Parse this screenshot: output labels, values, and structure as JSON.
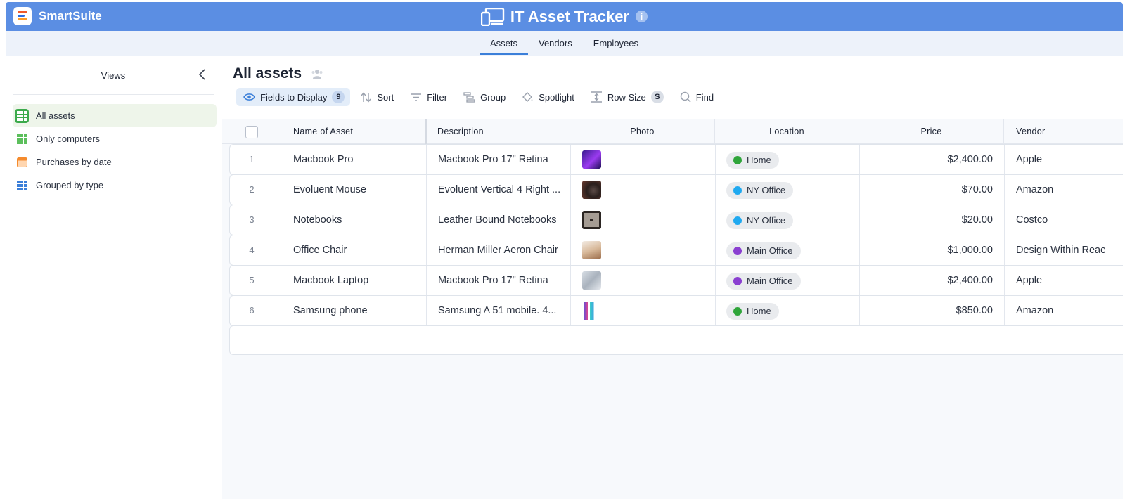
{
  "brand": {
    "name": "SmartSuite"
  },
  "app": {
    "title": "IT Asset Tracker",
    "info": "i"
  },
  "tabs": [
    {
      "label": "Assets",
      "active": true
    },
    {
      "label": "Vendors",
      "active": false
    },
    {
      "label": "Employees",
      "active": false
    }
  ],
  "sidebar": {
    "title": "Views",
    "items": [
      {
        "label": "All assets",
        "icon": "grid-icon",
        "active": true
      },
      {
        "label": "Only computers",
        "icon": "grid-icon",
        "active": false
      },
      {
        "label": "Purchases by date",
        "icon": "calendar-icon",
        "active": false
      },
      {
        "label": "Grouped by type",
        "icon": "grid-icon",
        "active": false
      }
    ]
  },
  "main": {
    "title": "All assets",
    "toolbar": {
      "fields": {
        "label": "Fields to Display",
        "count": "9"
      },
      "sort": "Sort",
      "filter": "Filter",
      "group": "Group",
      "spotlight": "Spotlight",
      "rowsize": {
        "label": "Row Size",
        "value": "S"
      },
      "find": "Find"
    }
  },
  "table": {
    "columns": {
      "name": "Name of Asset",
      "description": "Description",
      "photo": "Photo",
      "location": "Location",
      "price": "Price",
      "vendor": "Vendor"
    },
    "rows": [
      {
        "num": "1",
        "name": "Macbook Pro",
        "description": "Macbook Pro 17\" Retina",
        "location": "Home",
        "location_color": "#2fa53a",
        "price": "$2,400.00",
        "vendor": "Apple"
      },
      {
        "num": "2",
        "name": "Evoluent Mouse",
        "description": "Evoluent Vertical 4 Right ...",
        "location": "NY Office",
        "location_color": "#1fa9f0",
        "price": "$70.00",
        "vendor": "Amazon"
      },
      {
        "num": "3",
        "name": "Notebooks",
        "description": "Leather Bound Notebooks",
        "location": "NY Office",
        "location_color": "#1fa9f0",
        "price": "$20.00",
        "vendor": "Costco"
      },
      {
        "num": "4",
        "name": "Office Chair",
        "description": "Herman Miller Aeron Chair",
        "location": "Main Office",
        "location_color": "#8a3fd1",
        "price": "$1,000.00",
        "vendor": "Design Within Reac"
      },
      {
        "num": "5",
        "name": "Macbook Laptop",
        "description": "Macbook Pro 17\" Retina",
        "location": "Main Office",
        "location_color": "#8a3fd1",
        "price": "$2,400.00",
        "vendor": "Apple"
      },
      {
        "num": "6",
        "name": "Samsung phone",
        "description": "Samsung A 51 mobile. 4...",
        "location": "Home",
        "location_color": "#2fa53a",
        "price": "$850.00",
        "vendor": "Amazon"
      }
    ]
  },
  "colors": {
    "header": "#5b8ee3",
    "accent": "#3b7fd9",
    "active_view": "#3caa4c"
  }
}
